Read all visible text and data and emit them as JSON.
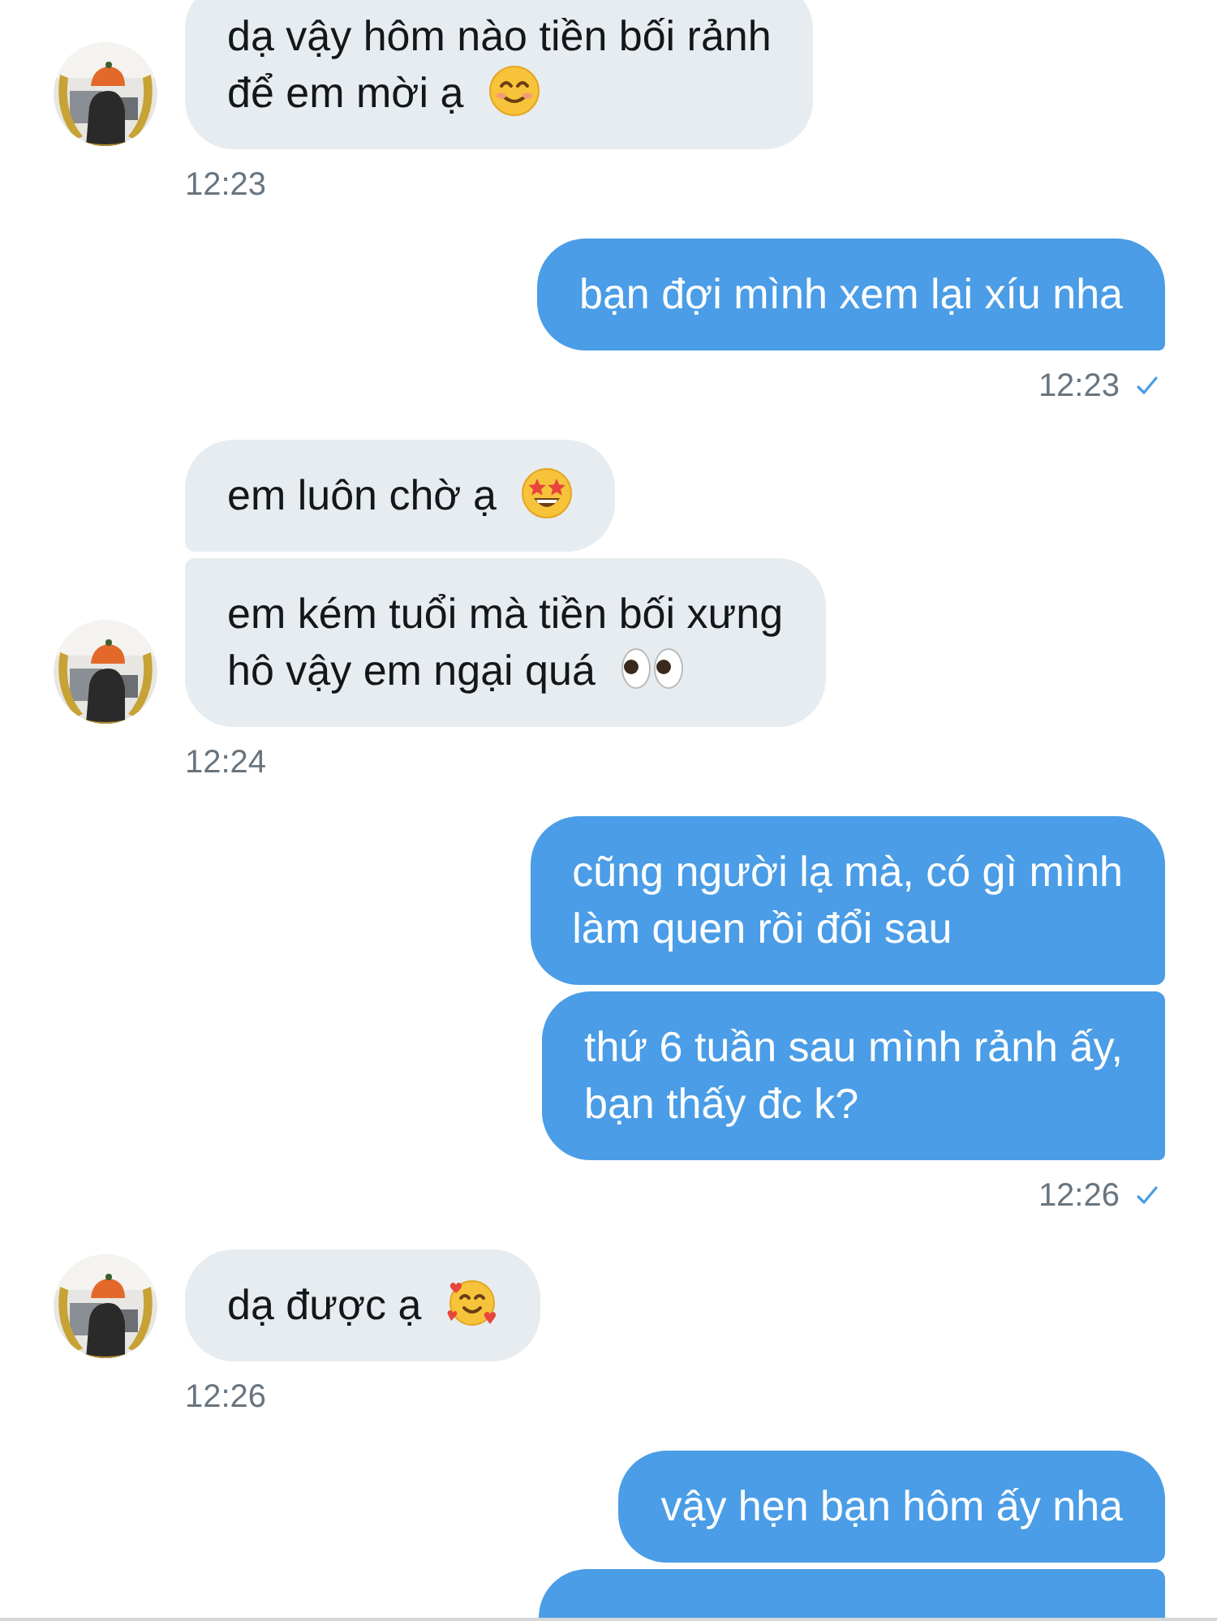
{
  "messages": [
    {
      "kind": "incoming",
      "bubbles": [
        {
          "kind": "smile",
          "lines": [
            "dạ vậy hôm nào tiền bối rảnh",
            "để em mời ạ"
          ]
        }
      ],
      "time": "12:23"
    },
    {
      "kind": "outgoing",
      "bubbles": [
        {
          "kind": "plain",
          "text": "bạn đợi mình xem lại xíu nha"
        }
      ],
      "time": "12:23",
      "read": true
    },
    {
      "kind": "incoming",
      "bubbles": [
        {
          "kind": "star-eyes",
          "text": "em luôn chờ ạ"
        },
        {
          "kind": "eyes",
          "lines": [
            "em kém tuổi mà tiền bối xưng",
            "hô vậy em ngại quá"
          ]
        }
      ],
      "time": "12:24"
    },
    {
      "kind": "outgoing",
      "bubbles": [
        {
          "kind": "plain",
          "text": "cũng người lạ mà, có gì mình\nlàm quen rồi đổi sau"
        },
        {
          "kind": "plain",
          "text": "thứ 6 tuần sau mình rảnh ấy,\nbạn thấy đc k?"
        }
      ],
      "time": "12:26",
      "read": true
    },
    {
      "kind": "incoming",
      "bubbles": [
        {
          "kind": "hearts",
          "text": "dạ được ạ"
        }
      ],
      "time": "12:26"
    },
    {
      "kind": "outgoing",
      "bubbles": [
        {
          "kind": "plain",
          "text": "vậy hẹn bạn hôm ấy nha"
        },
        {
          "kind": "cut"
        }
      ]
    }
  ]
}
